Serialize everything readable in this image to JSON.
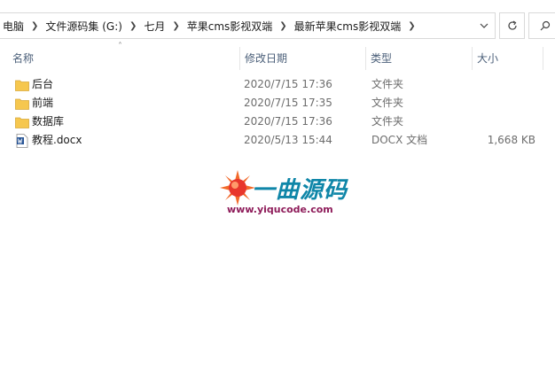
{
  "address": {
    "crumbs": [
      "电脑",
      "文件源码集 (G:)",
      "七月",
      "苹果cms影视双端",
      "最新苹果cms影视双端"
    ]
  },
  "columns": {
    "name": "名称",
    "date": "修改日期",
    "type": "类型",
    "size": "大小"
  },
  "files": [
    {
      "name": "后台",
      "date": "2020/7/15 17:36",
      "type": "文件夹",
      "size": "",
      "icon": "folder-icon"
    },
    {
      "name": "前端",
      "date": "2020/7/15 17:35",
      "type": "文件夹",
      "size": "",
      "icon": "folder-icon"
    },
    {
      "name": "数据库",
      "date": "2020/7/15 17:36",
      "type": "文件夹",
      "size": "",
      "icon": "folder-icon"
    },
    {
      "name": "教程.docx",
      "date": "2020/5/13 15:44",
      "type": "DOCX 文档",
      "size": "1,668 KB",
      "icon": "word-doc-icon"
    }
  ],
  "watermark": {
    "title": "一曲源码",
    "url": "www.yiqucode.com"
  },
  "colors": {
    "folder": "#f6c74e",
    "header_text": "#4c607a",
    "logo_blue": "#0f86a8",
    "logo_url": "#8e1c5a"
  }
}
